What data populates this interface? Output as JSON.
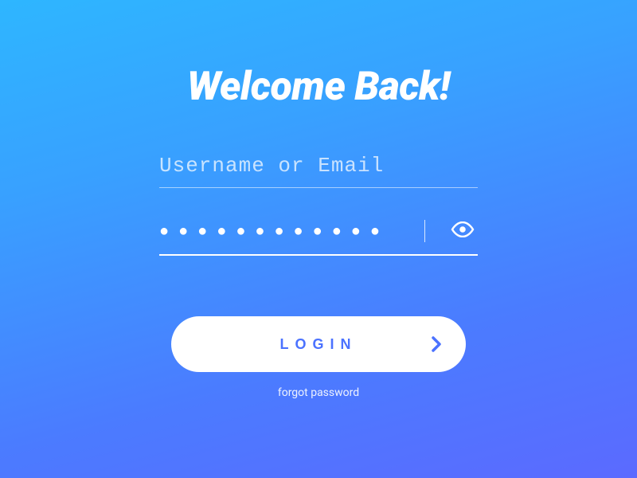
{
  "heading": "Welcome Back!",
  "form": {
    "username": {
      "placeholder": "Username or Email",
      "value": ""
    },
    "password": {
      "masked_value": "●●●●●●●●●●●●"
    },
    "login_label": "LOGIN",
    "forgot_label": "forgot password"
  },
  "colors": {
    "gradient_start": "#2eb6ff",
    "gradient_end": "#5b6aff",
    "button_bg": "#ffffff",
    "button_text": "#4b72ff"
  }
}
